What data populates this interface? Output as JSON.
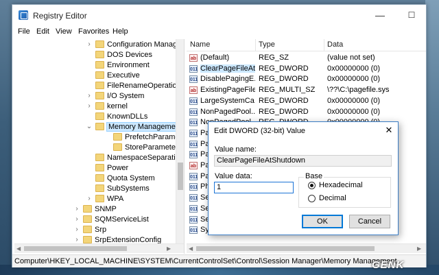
{
  "window": {
    "title": "Registry Editor",
    "minimize": "—",
    "maximize": "☐",
    "close": "✕"
  },
  "menu": [
    "File",
    "Edit",
    "View",
    "Favorites",
    "Help"
  ],
  "tree": [
    {
      "label": "Configuration Manage",
      "depth": 1,
      "arrow": "›"
    },
    {
      "label": "DOS Devices",
      "depth": 1,
      "arrow": ""
    },
    {
      "label": "Environment",
      "depth": 1,
      "arrow": ""
    },
    {
      "label": "Executive",
      "depth": 1,
      "arrow": ""
    },
    {
      "label": "FileRenameOperations",
      "depth": 1,
      "arrow": ""
    },
    {
      "label": "I/O System",
      "depth": 1,
      "arrow": "›"
    },
    {
      "label": "kernel",
      "depth": 1,
      "arrow": "›"
    },
    {
      "label": "KnownDLLs",
      "depth": 1,
      "arrow": ""
    },
    {
      "label": "Memory Management",
      "depth": 1,
      "arrow": "⌄",
      "selected": true
    },
    {
      "label": "PrefetchParameters",
      "depth": 2,
      "arrow": ""
    },
    {
      "label": "StoreParameters",
      "depth": 2,
      "arrow": ""
    },
    {
      "label": "NamespaceSeparation",
      "depth": 1,
      "arrow": ""
    },
    {
      "label": "Power",
      "depth": 1,
      "arrow": ""
    },
    {
      "label": "Quota System",
      "depth": 1,
      "arrow": ""
    },
    {
      "label": "SubSystems",
      "depth": 1,
      "arrow": ""
    },
    {
      "label": "WPA",
      "depth": 1,
      "arrow": "›"
    },
    {
      "label": "SNMP",
      "depth": 0,
      "arrow": "›"
    },
    {
      "label": "SQMServiceList",
      "depth": 0,
      "arrow": "›"
    },
    {
      "label": "Srp",
      "depth": 0,
      "arrow": "›"
    },
    {
      "label": "SrpExtensionConfig",
      "depth": 0,
      "arrow": "›"
    }
  ],
  "list": {
    "headers": [
      "Name",
      "Type",
      "Data"
    ],
    "rows": [
      {
        "name": "(Default)",
        "type": "REG_SZ",
        "data": "(value not set)",
        "icon": "ab"
      },
      {
        "name": "ClearPageFileAt...",
        "type": "REG_DWORD",
        "data": "0x00000000 (0)",
        "icon": "011",
        "selected": true
      },
      {
        "name": "DisablePagingE...",
        "type": "REG_DWORD",
        "data": "0x00000000 (0)",
        "icon": "011"
      },
      {
        "name": "ExistingPageFiles",
        "type": "REG_MULTI_SZ",
        "data": "\\??\\C:\\pagefile.sys",
        "icon": "ab"
      },
      {
        "name": "LargeSystemCa...",
        "type": "REG_DWORD",
        "data": "0x00000000 (0)",
        "icon": "011"
      },
      {
        "name": "NonPagedPool...",
        "type": "REG_DWORD",
        "data": "0x00000000 (0)",
        "icon": "011"
      },
      {
        "name": "NonPagedPool...",
        "type": "REG_DWORD",
        "data": "0x00000000 (0)",
        "icon": "011"
      },
      {
        "name": "Pa",
        "type": "",
        "data": "",
        "icon": "011"
      },
      {
        "name": "Pa",
        "type": "",
        "data": "1 3c 00 00 3",
        "icon": "011"
      },
      {
        "name": "Pa",
        "type": "",
        "data": "",
        "icon": "011"
      },
      {
        "name": "Pa",
        "type": "",
        "data": "",
        "icon": "ab"
      },
      {
        "name": "Pa",
        "type": "",
        "data": "",
        "icon": "011"
      },
      {
        "name": "Phy",
        "type": "",
        "data": "",
        "icon": "011"
      },
      {
        "name": "Sec",
        "type": "",
        "data": "",
        "icon": "011"
      },
      {
        "name": "Ses",
        "type": "",
        "data": "",
        "icon": "011"
      },
      {
        "name": "Ses",
        "type": "",
        "data": "",
        "icon": "011"
      },
      {
        "name": "Sys",
        "type": "",
        "data": "",
        "icon": "011"
      }
    ]
  },
  "status": "Computer\\HKEY_LOCAL_MACHINE\\SYSTEM\\CurrentControlSet\\Control\\Session Manager\\Memory Management",
  "dialog": {
    "title": "Edit DWORD (32-bit) Value",
    "close": "✕",
    "value_name_label": "Value name:",
    "value_name": "ClearPageFileAtShutdown",
    "value_data_label": "Value data:",
    "value_data": "1",
    "base_label": "Base",
    "hex_label": "Hexadecimal",
    "dec_label": "Decimal",
    "ok": "OK",
    "cancel": "Cancel"
  },
  "watermark": "GENK"
}
